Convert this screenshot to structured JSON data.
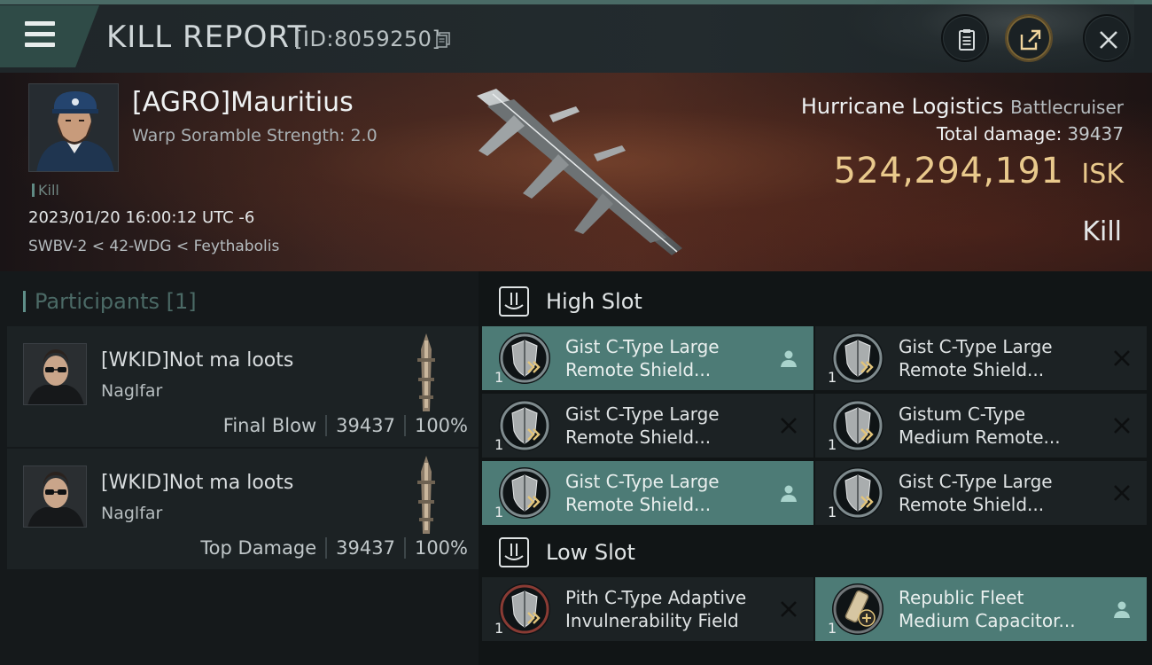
{
  "header": {
    "title": "KILL REPORT",
    "id_text": "[ID:8059250]"
  },
  "victim": {
    "name": "[AGRO]Mauritius",
    "warp_strength": "Warp Soramble Strength: 2.0",
    "kill_tag": "Kill",
    "datetime": "2023/01/20 16:00:12 UTC -6",
    "location": "SWBV-2 < 42-WDG < Feythabolis"
  },
  "ship": {
    "name": "Hurricane Logistics",
    "class": "Battlecruiser",
    "total_damage_label": "Total damage:",
    "total_damage": "39437",
    "isk_value": "524,294,191",
    "isk_unit": "ISK",
    "result": "Kill"
  },
  "participants": {
    "label": "Participants [1]",
    "list": [
      {
        "name": "[WKID]Not ma loots",
        "ship": "Naglfar",
        "role": "Final Blow",
        "damage": "39437",
        "percent": "100%"
      },
      {
        "name": "[WKID]Not ma loots",
        "ship": "Naglfar",
        "role": "Top Damage",
        "damage": "39437",
        "percent": "100%"
      }
    ]
  },
  "high_slot": {
    "label": "High Slot",
    "modules": [
      {
        "line1": "Gist C-Type Large",
        "line2": "Remote Shield...",
        "qty": "1",
        "status": "user"
      },
      {
        "line1": "Gist C-Type Large",
        "line2": "Remote Shield...",
        "qty": "1",
        "status": "destroyed"
      },
      {
        "line1": "Gist C-Type Large",
        "line2": "Remote Shield...",
        "qty": "1",
        "status": "destroyed"
      },
      {
        "line1": "Gistum C-Type",
        "line2": "Medium Remote...",
        "qty": "1",
        "status": "destroyed"
      },
      {
        "line1": "Gist C-Type Large",
        "line2": "Remote Shield...",
        "qty": "1",
        "status": "user"
      },
      {
        "line1": "Gist C-Type Large",
        "line2": "Remote Shield...",
        "qty": "1",
        "status": "destroyed"
      }
    ]
  },
  "low_slot": {
    "label": "Low Slot",
    "modules": [
      {
        "line1": "Pith C-Type Adaptive",
        "line2": "Invulnerability Field",
        "qty": "1",
        "status": "destroyed"
      },
      {
        "line1": "Republic Fleet",
        "line2": "Medium Capacitor...",
        "qty": "1",
        "status": "user"
      }
    ]
  },
  "colors": {
    "accent": "#4d7b76",
    "isk_gold": "#e9c98c",
    "panel": "#1c2224"
  },
  "icons": [
    "menu-icon",
    "copy-icon",
    "clipboard-icon",
    "share-icon",
    "close-icon",
    "slot-icon",
    "shield-module-icon",
    "capacitor-module-icon",
    "user-icon",
    "destroyed-x-icon"
  ]
}
